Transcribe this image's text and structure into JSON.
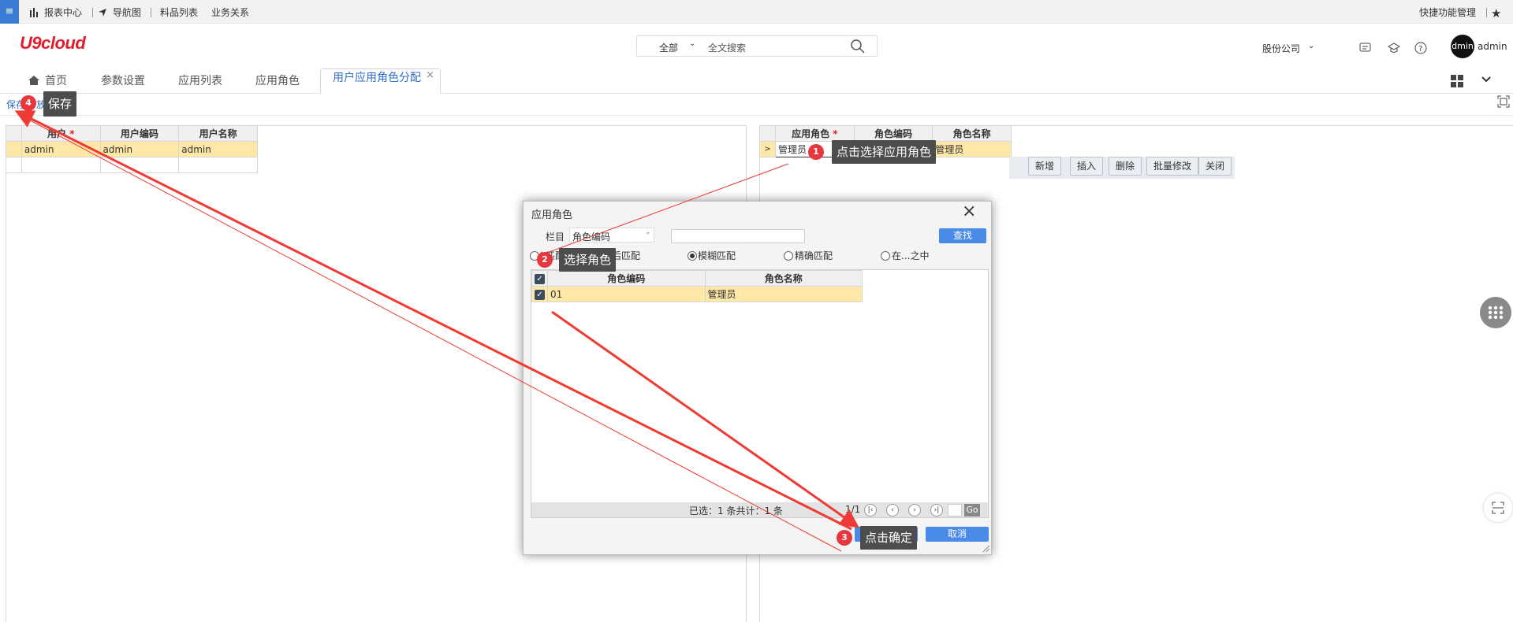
{
  "topbar": {
    "menu_icon": "≡",
    "nav": [
      "报表中心",
      "导航图",
      "料品列表",
      "业务关系"
    ],
    "quick_label": "快捷功能管理"
  },
  "header": {
    "logo": "U9cloud",
    "search_scope": "全部",
    "search_placeholder": "全文搜索",
    "company": "股份公司",
    "avatar_text": "dmin",
    "user": "admin"
  },
  "tabs": {
    "home": "首页",
    "items": [
      "参数设置",
      "应用列表",
      "应用角色"
    ],
    "active": "用户应用角色分配",
    "close": "×"
  },
  "toolbar": {
    "save": "保存",
    "partial": "放"
  },
  "left_grid": {
    "headers": [
      "用户",
      "用户编码",
      "用户名称"
    ],
    "required_mark": "*",
    "rows": [
      [
        "admin",
        "admin",
        "admin"
      ]
    ]
  },
  "right_grid": {
    "headers": [
      "应用角色",
      "角色编码",
      "角色名称"
    ],
    "required_mark": "*",
    "row_marker": ">",
    "rows": [
      [
        "管理员",
        "",
        "管理员"
      ]
    ],
    "buttons": [
      "新增",
      "插入",
      "删除",
      "批量修改",
      "关闭"
    ]
  },
  "dialog": {
    "title": "应用角色",
    "close": "×",
    "field_label": "栏目",
    "field_value": "角色编码",
    "search_value": "",
    "find_button": "查找",
    "radios": [
      {
        "label": "匹配",
        "checked": false
      },
      {
        "label": "后匹配",
        "checked": false
      },
      {
        "label": "模糊匹配",
        "checked": true
      },
      {
        "label": "精确匹配",
        "checked": false
      },
      {
        "label": "在...之中",
        "checked": false
      }
    ],
    "headers": [
      "角色编码",
      "角色名称"
    ],
    "rows": [
      [
        "01",
        "管理员"
      ]
    ],
    "summary": "已选：1 条共计：1 条",
    "page": "1/1",
    "go": "Go",
    "ok_button": "确定",
    "cancel_button": "取消"
  },
  "annotations": [
    {
      "num": "1",
      "text": "点击选择应用角色"
    },
    {
      "num": "2",
      "text": "选择角色"
    },
    {
      "num": "3",
      "text": "点击确定"
    },
    {
      "num": "4",
      "text": "保存"
    }
  ],
  "colors": {
    "accent": "#4a8ae8",
    "brand": "#e01d2a",
    "selected_row": "#fde8a7",
    "arrow": "#ee3b35"
  }
}
